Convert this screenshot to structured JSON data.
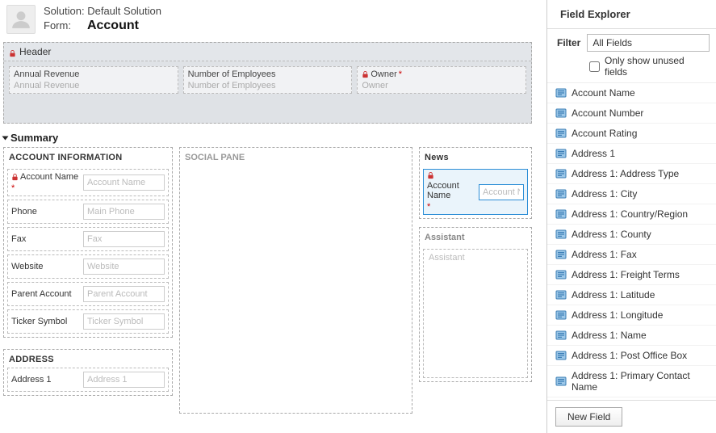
{
  "top": {
    "solution_label": "Solution:",
    "solution_name": "Default Solution",
    "form_label": "Form:",
    "form_name": "Account"
  },
  "header_section": {
    "title": "Header",
    "fields": [
      {
        "label": "Annual Revenue",
        "placeholder": "Annual Revenue",
        "locked": false,
        "required": false
      },
      {
        "label": "Number of Employees",
        "placeholder": "Number of Employees",
        "locked": false,
        "required": false
      },
      {
        "label": "Owner",
        "placeholder": "Owner",
        "locked": true,
        "required": true
      }
    ]
  },
  "summary": {
    "title": "Summary",
    "account_info_title": "ACCOUNT INFORMATION",
    "account_info_fields": [
      {
        "label": "Account Name",
        "placeholder": "Account Name",
        "locked": true,
        "required": true
      },
      {
        "label": "Phone",
        "placeholder": "Main Phone",
        "locked": false,
        "required": false
      },
      {
        "label": "Fax",
        "placeholder": "Fax",
        "locked": false,
        "required": false
      },
      {
        "label": "Website",
        "placeholder": "Website",
        "locked": false,
        "required": false
      },
      {
        "label": "Parent Account",
        "placeholder": "Parent Account",
        "locked": false,
        "required": false
      },
      {
        "label": "Ticker Symbol",
        "placeholder": "Ticker Symbol",
        "locked": false,
        "required": false
      }
    ],
    "social_pane_title": "SOCIAL PANE",
    "news_title": "News",
    "news_field": {
      "label": "Account Name",
      "placeholder": "Account Nam",
      "locked": true,
      "required": true
    },
    "assistant_title": "Assistant",
    "assistant_placeholder": "Assistant",
    "address_title": "ADDRESS",
    "address_field": {
      "label": "Address 1",
      "placeholder": "Address 1"
    }
  },
  "field_explorer": {
    "title": "Field Explorer",
    "filter_label": "Filter",
    "filter_value": "All Fields",
    "only_unused_label": "Only show unused fields",
    "only_unused_checked": false,
    "fields": [
      "Account Name",
      "Account Number",
      "Account Rating",
      "Address 1",
      "Address 1: Address Type",
      "Address 1: City",
      "Address 1: Country/Region",
      "Address 1: County",
      "Address 1: Fax",
      "Address 1: Freight Terms",
      "Address 1: Latitude",
      "Address 1: Longitude",
      "Address 1: Name",
      "Address 1: Post Office Box",
      "Address 1: Primary Contact Name"
    ],
    "new_field_label": "New Field"
  }
}
